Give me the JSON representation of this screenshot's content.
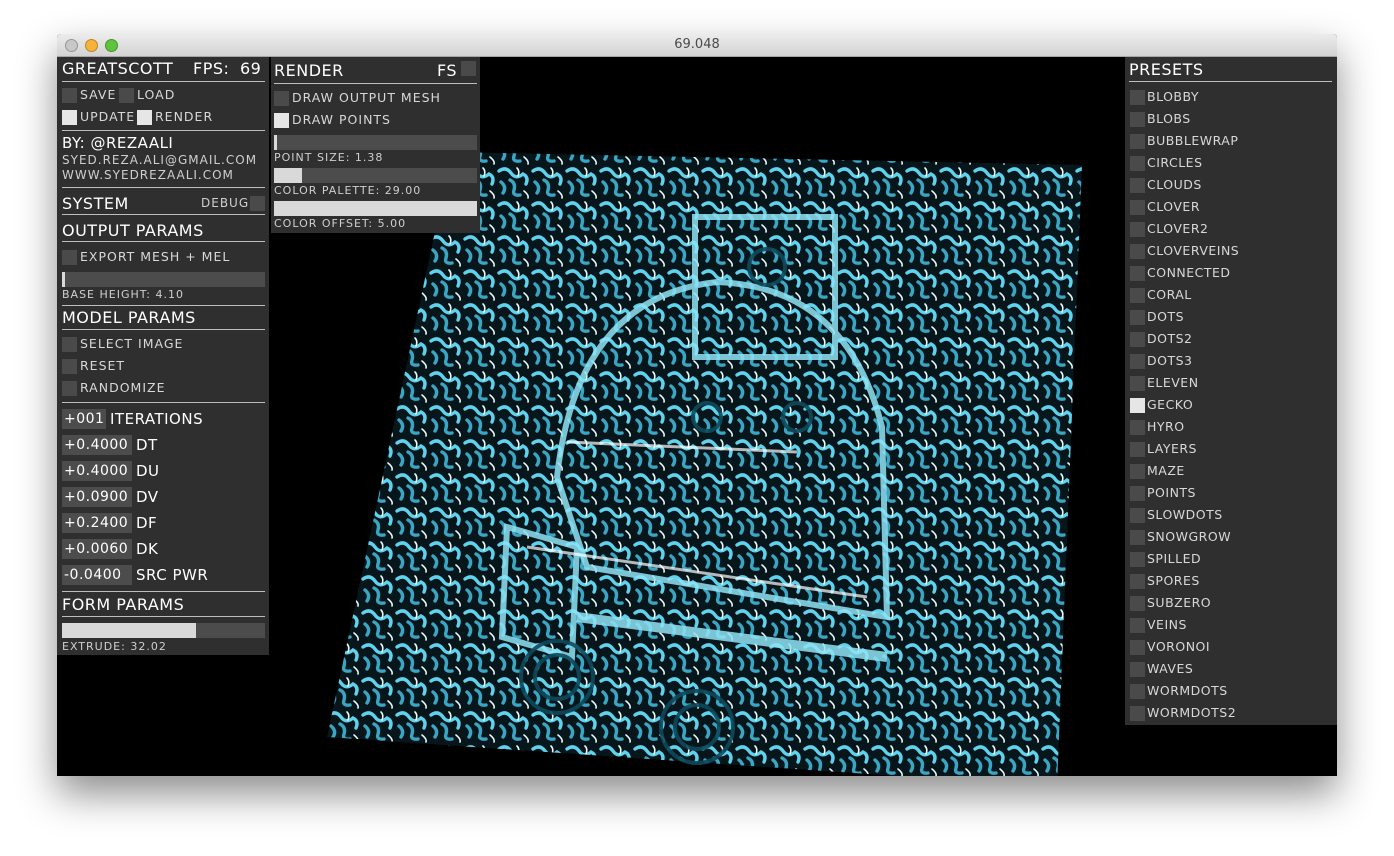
{
  "window": {
    "title": "69.048"
  },
  "left_panel": {
    "app_name": "GREATSCOTT",
    "fps_label": "FPS:",
    "fps_value": "69",
    "save": {
      "label": "SAVE",
      "checked": false
    },
    "load": {
      "label": "LOAD",
      "checked": false
    },
    "update": {
      "label": "UPDATE",
      "checked": true
    },
    "render": {
      "label": "RENDER",
      "checked": true
    },
    "by_line": "BY: @REZAALI",
    "email": "SYED.REZA.ALI@GMAIL.COM",
    "website": "WWW.SYEDREZAALI.COM",
    "system_header": "SYSTEM",
    "debug_label": "DEBUG",
    "output_header": "OUTPUT PARAMS",
    "export_label": "EXPORT MESH + MEL",
    "base_height_label": "BASE HEIGHT: 4.10",
    "base_height_value": 0.02,
    "model_header": "MODEL PARAMS",
    "select_image_label": "SELECT IMAGE",
    "reset_label": "RESET",
    "randomize_label": "RANDOMIZE",
    "params": [
      {
        "value": "+001",
        "name": "ITERATIONS"
      },
      {
        "value": "+0.4000",
        "name": "DT"
      },
      {
        "value": "+0.4000",
        "name": "DU"
      },
      {
        "value": "+0.0900",
        "name": "DV"
      },
      {
        "value": "+0.2400",
        "name": "DF"
      },
      {
        "value": "+0.0060",
        "name": "DK"
      },
      {
        "value": "-0.0400",
        "name": "SRC PWR"
      }
    ],
    "form_header": "FORM PARAMS",
    "extrude_label": "EXTRUDE: 32.02",
    "extrude_value": 0.66
  },
  "render_panel": {
    "header": "RENDER",
    "fs_label": "FS",
    "draw_mesh_label": "DRAW OUTPUT MESH",
    "draw_points_label": "DRAW POINTS",
    "draw_points_checked": true,
    "point_size_label": "POINT SIZE: 1.38",
    "point_size_value": 0.02,
    "color_palette_label": "COLOR PALETTE: 29.00",
    "color_palette_value": 0.14,
    "color_offset_label": "COLOR OFFSET: 5.00",
    "color_offset_value": 1.0
  },
  "presets_panel": {
    "header": "PRESETS",
    "items": [
      {
        "label": "BLOBBY",
        "selected": false
      },
      {
        "label": "BLOBS",
        "selected": false
      },
      {
        "label": "BUBBLEWRAP",
        "selected": false
      },
      {
        "label": "CIRCLES",
        "selected": false
      },
      {
        "label": "CLOUDS",
        "selected": false
      },
      {
        "label": "CLOVER",
        "selected": false
      },
      {
        "label": "CLOVER2",
        "selected": false
      },
      {
        "label": "CLOVERVEINS",
        "selected": false
      },
      {
        "label": "CONNECTED",
        "selected": false
      },
      {
        "label": "CORAL",
        "selected": false
      },
      {
        "label": "DOTS",
        "selected": false
      },
      {
        "label": "DOTS2",
        "selected": false
      },
      {
        "label": "DOTS3",
        "selected": false
      },
      {
        "label": "ELEVEN",
        "selected": false
      },
      {
        "label": "GECKO",
        "selected": true
      },
      {
        "label": "HYRO",
        "selected": false
      },
      {
        "label": "LAYERS",
        "selected": false
      },
      {
        "label": "MAZE",
        "selected": false
      },
      {
        "label": "POINTS",
        "selected": false
      },
      {
        "label": "SLOWDOTS",
        "selected": false
      },
      {
        "label": "SNOWGROW",
        "selected": false
      },
      {
        "label": "SPILLED",
        "selected": false
      },
      {
        "label": "SPORES",
        "selected": false
      },
      {
        "label": "SUBZERO",
        "selected": false
      },
      {
        "label": "VEINS",
        "selected": false
      },
      {
        "label": "VORONOI",
        "selected": false
      },
      {
        "label": "WAVES",
        "selected": false
      },
      {
        "label": "WORMDOTS",
        "selected": false
      },
      {
        "label": "WORMDOTS2",
        "selected": false
      }
    ]
  },
  "colors": {
    "mesh": "#3fb8d6",
    "mesh_dark": "#1d7f9a",
    "panel": "#2f2f2f",
    "control": "#4a4a4a"
  }
}
